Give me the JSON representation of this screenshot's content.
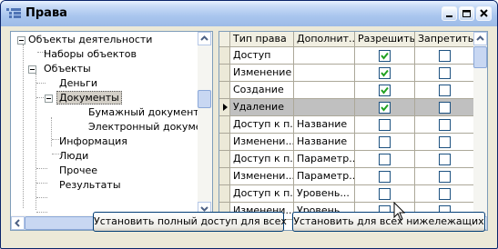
{
  "window": {
    "title": "Права"
  },
  "tree": {
    "items": [
      {
        "label": "Объекты деятельности",
        "level": 0,
        "expanded": true
      },
      {
        "label": "Наборы объектов",
        "level": 1
      },
      {
        "label": "Объекты",
        "level": 1,
        "expanded": true
      },
      {
        "label": "Деньги",
        "level": 2
      },
      {
        "label": "Документы",
        "level": 2,
        "expanded": true,
        "selected": true
      },
      {
        "label": "Бумажный документ",
        "level": 3
      },
      {
        "label": "Электронный документ",
        "level": 3
      },
      {
        "label": "Информация",
        "level": 2
      },
      {
        "label": "Люди",
        "level": 2
      },
      {
        "label": "Прочее",
        "level": 2
      },
      {
        "label": "Результаты",
        "level": 2
      }
    ]
  },
  "grid": {
    "columns": [
      "Тип права",
      "Дополнит...",
      "Разрешить",
      "Запретить"
    ],
    "rows": [
      {
        "type": "Доступ",
        "extra": "",
        "allow": true,
        "deny": false
      },
      {
        "type": "Изменение",
        "extra": "",
        "allow": true,
        "deny": false
      },
      {
        "type": "Создание",
        "extra": "",
        "allow": true,
        "deny": false
      },
      {
        "type": "Удаление",
        "extra": "",
        "allow": true,
        "deny": false,
        "current": true
      },
      {
        "type": "Доступ к п...",
        "extra": "Название",
        "allow": false,
        "deny": false
      },
      {
        "type": "Изменени...",
        "extra": "Название",
        "allow": false,
        "deny": false
      },
      {
        "type": "Доступ к п...",
        "extra": "Параметр...",
        "allow": false,
        "deny": false
      },
      {
        "type": "Изменени...",
        "extra": "Параметр...",
        "allow": false,
        "deny": false
      },
      {
        "type": "Доступ к п...",
        "extra": "Уровень...",
        "allow": false,
        "deny": false
      },
      {
        "type": "Изменени...",
        "extra": "Уровень...",
        "allow": false,
        "deny": false
      }
    ]
  },
  "buttons": {
    "full_access": "Установить полный доступ для всех",
    "set_below": "Установить для всех нижележащих"
  },
  "icons": {
    "app": "app-icon",
    "minimize": "minimize-icon",
    "maximize": "maximize-icon",
    "close": "close-icon"
  },
  "colors": {
    "title_bar": "#9dbbe7",
    "selected_row": "#c0c0c0",
    "check": "#21a121"
  }
}
